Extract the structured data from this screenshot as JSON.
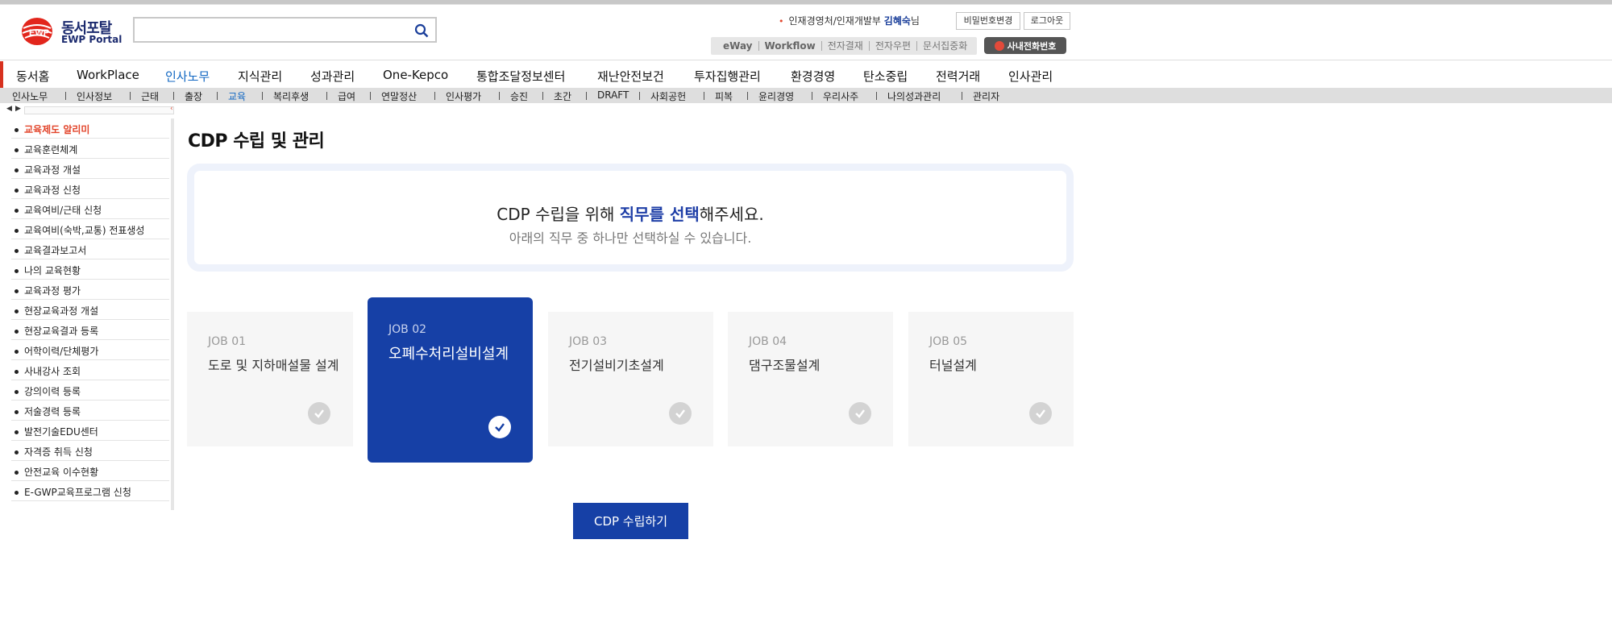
{
  "header": {
    "logo_title": "동서포탈",
    "logo_subtitle": "EWP Portal",
    "search_value": "",
    "user_dept": "인재경영처/인재개발부",
    "user_name": "김혜숙",
    "user_suffix": "님",
    "change_pw_label": "비밀번호변경",
    "logout_label": "로그아웃",
    "quick_links": [
      "eWay",
      "Workflow",
      "전자결재",
      "전자우편",
      "문서집중화"
    ],
    "phone_label": "사내전화번호"
  },
  "main_nav": {
    "items": [
      "동서홈",
      "WorkPlace",
      "인사노무",
      "지식관리",
      "성과관리",
      "One-Kepco",
      "통합조달정보센터",
      "재난안전보건",
      "투자집행관리",
      "환경경영",
      "탄소중립",
      "전력거래",
      "인사관리"
    ],
    "active": "인사노무"
  },
  "sub_nav": {
    "items": [
      "인사노무",
      "인사정보",
      "근태",
      "출장",
      "교육",
      "복리후생",
      "급여",
      "연말정산",
      "인사평가",
      "승진",
      "초간",
      "DRAFT",
      "사회공헌",
      "피복",
      "윤리경영",
      "우리사주",
      "나의성과관리",
      "관리자"
    ],
    "active": "교육"
  },
  "sidebar": {
    "items": [
      "교육제도 알리미",
      "교육훈련체계",
      "교육과정 개설",
      "교육과정 신청",
      "교육여비/근태 신청",
      "교육여비(숙박,교통) 전표생성",
      "교육결과보고서",
      "나의 교육현황",
      "교육과정 평가",
      "현장교육과정 개설",
      "현장교육결과 등록",
      "어학이력/단체평가",
      "사내강사 조회",
      "강의이력 등록",
      "저술경력 등록",
      "발전기술EDU센터",
      "자격증 취득 신청",
      "안전교육 이수현황",
      "E-GWP교육프로그램 신청"
    ],
    "active": "교육제도 알리미"
  },
  "content": {
    "title": "CDP 수립 및 관리",
    "notice_pre": "CDP 수립을 위해 ",
    "notice_highlight": "직무를 선택",
    "notice_post": "해주세요.",
    "notice_sub": "아래의 직무 중 하나만 선택하실 수 있습니다.",
    "jobs": [
      {
        "number": "JOB 01",
        "name": "도로 및 지하매설물 설계",
        "selected": false
      },
      {
        "number": "JOB 02",
        "name": "오폐수처리설비설계",
        "selected": true
      },
      {
        "number": "JOB 03",
        "name": "전기설비기초설계",
        "selected": false
      },
      {
        "number": "JOB 04",
        "name": "댐구조물설계",
        "selected": false
      },
      {
        "number": "JOB 05",
        "name": "터널설계",
        "selected": false
      }
    ],
    "submit_label": "CDP 수립하기"
  },
  "colors": {
    "accent_blue": "#1640a6",
    "nav_active": "#1066c2",
    "sidebar_active": "#e2442a",
    "brand_red": "#d7311f"
  }
}
